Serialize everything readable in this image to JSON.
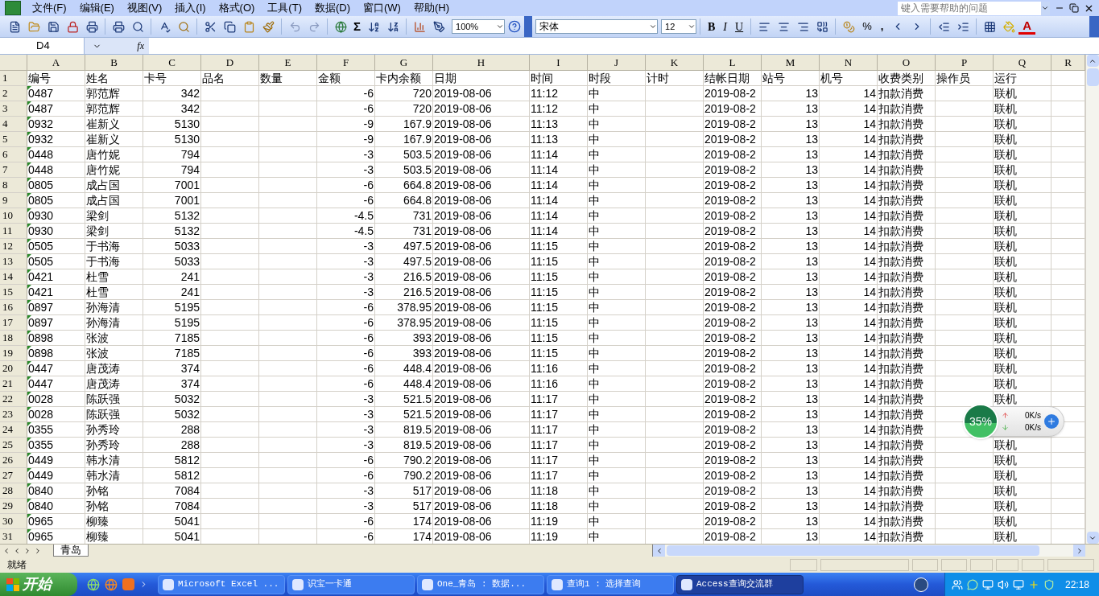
{
  "menu_bar": [
    "文件(F)",
    "编辑(E)",
    "视图(V)",
    "插入(I)",
    "格式(O)",
    "工具(T)",
    "数据(D)",
    "窗口(W)",
    "帮助(H)"
  ],
  "help_field": {
    "placeholder": "键入需要帮助的问题"
  },
  "standard_toolbar": {
    "sum": "Σ",
    "zoom": "100%"
  },
  "formatting_toolbar": {
    "font": "宋体",
    "size": "12",
    "bold": "B",
    "italic": "I",
    "underline": "U",
    "percent": "%",
    "comma": ",",
    "font_color": "A"
  },
  "formula_bar": {
    "name_box": "D4",
    "fx": "fx"
  },
  "columns": [
    "A",
    "B",
    "C",
    "D",
    "E",
    "F",
    "G",
    "H",
    "I",
    "J",
    "K",
    "L",
    "M",
    "N",
    "O",
    "P",
    "Q",
    "R"
  ],
  "rows": [
    {
      "number": "1",
      "cells": {
        "A": "编号",
        "B": "姓名",
        "C": "卡号",
        "D": "品名",
        "E": "数量",
        "F": "金额",
        "G": "卡内余额",
        "H": "日期",
        "I": "时间",
        "J": "时段",
        "K": "计时",
        "L": "结帐日期",
        "M": "站号",
        "N": "机号",
        "O": "收费类别",
        "P": "操作员",
        "Q": "运行"
      }
    },
    {
      "number": "2",
      "cells": {
        "A": "0487",
        "B": "郭范辉",
        "C": "342",
        "F": "-6",
        "G": "720",
        "H": "2019-08-06",
        "I": "11:12",
        "J": "中",
        "L": "2019-08-2",
        "M": "13",
        "N": "14",
        "O": "扣款消费",
        "Q": "联机"
      }
    },
    {
      "number": "3",
      "cells": {
        "A": "0487",
        "B": "郭范辉",
        "C": "342",
        "F": "-6",
        "G": "720",
        "H": "2019-08-06",
        "I": "11:12",
        "J": "中",
        "L": "2019-08-2",
        "M": "13",
        "N": "14",
        "O": "扣款消费",
        "Q": "联机"
      }
    },
    {
      "number": "4",
      "cells": {
        "A": "0932",
        "B": "崔新义",
        "C": "5130",
        "F": "-9",
        "G": "167.9",
        "H": "2019-08-06",
        "I": "11:13",
        "J": "中",
        "L": "2019-08-2",
        "M": "13",
        "N": "14",
        "O": "扣款消费",
        "Q": "联机"
      }
    },
    {
      "number": "5",
      "cells": {
        "A": "0932",
        "B": "崔新义",
        "C": "5130",
        "F": "-9",
        "G": "167.9",
        "H": "2019-08-06",
        "I": "11:13",
        "J": "中",
        "L": "2019-08-2",
        "M": "13",
        "N": "14",
        "O": "扣款消费",
        "Q": "联机"
      }
    },
    {
      "number": "6",
      "cells": {
        "A": "0448",
        "B": "唐竹妮",
        "C": "794",
        "F": "-3",
        "G": "503.5",
        "H": "2019-08-06",
        "I": "11:14",
        "J": "中",
        "L": "2019-08-2",
        "M": "13",
        "N": "14",
        "O": "扣款消费",
        "Q": "联机"
      }
    },
    {
      "number": "7",
      "cells": {
        "A": "0448",
        "B": "唐竹妮",
        "C": "794",
        "F": "-3",
        "G": "503.5",
        "H": "2019-08-06",
        "I": "11:14",
        "J": "中",
        "L": "2019-08-2",
        "M": "13",
        "N": "14",
        "O": "扣款消费",
        "Q": "联机"
      }
    },
    {
      "number": "8",
      "cells": {
        "A": "0805",
        "B": "成占国",
        "C": "7001",
        "F": "-6",
        "G": "664.8",
        "H": "2019-08-06",
        "I": "11:14",
        "J": "中",
        "L": "2019-08-2",
        "M": "13",
        "N": "14",
        "O": "扣款消费",
        "Q": "联机"
      }
    },
    {
      "number": "9",
      "cells": {
        "A": "0805",
        "B": "成占国",
        "C": "7001",
        "F": "-6",
        "G": "664.8",
        "H": "2019-08-06",
        "I": "11:14",
        "J": "中",
        "L": "2019-08-2",
        "M": "13",
        "N": "14",
        "O": "扣款消费",
        "Q": "联机"
      }
    },
    {
      "number": "10",
      "cells": {
        "A": "0930",
        "B": "梁剑",
        "C": "5132",
        "F": "-4.5",
        "G": "731",
        "H": "2019-08-06",
        "I": "11:14",
        "J": "中",
        "L": "2019-08-2",
        "M": "13",
        "N": "14",
        "O": "扣款消费",
        "Q": "联机"
      }
    },
    {
      "number": "11",
      "cells": {
        "A": "0930",
        "B": "梁剑",
        "C": "5132",
        "F": "-4.5",
        "G": "731",
        "H": "2019-08-06",
        "I": "11:14",
        "J": "中",
        "L": "2019-08-2",
        "M": "13",
        "N": "14",
        "O": "扣款消费",
        "Q": "联机"
      }
    },
    {
      "number": "12",
      "cells": {
        "A": "0505",
        "B": "于书海",
        "C": "5033",
        "F": "-3",
        "G": "497.5",
        "H": "2019-08-06",
        "I": "11:15",
        "J": "中",
        "L": "2019-08-2",
        "M": "13",
        "N": "14",
        "O": "扣款消费",
        "Q": "联机"
      }
    },
    {
      "number": "13",
      "cells": {
        "A": "0505",
        "B": "于书海",
        "C": "5033",
        "F": "-3",
        "G": "497.5",
        "H": "2019-08-06",
        "I": "11:15",
        "J": "中",
        "L": "2019-08-2",
        "M": "13",
        "N": "14",
        "O": "扣款消费",
        "Q": "联机"
      }
    },
    {
      "number": "14",
      "cells": {
        "A": "0421",
        "B": "杜雪",
        "C": "241",
        "F": "-3",
        "G": "216.5",
        "H": "2019-08-06",
        "I": "11:15",
        "J": "中",
        "L": "2019-08-2",
        "M": "13",
        "N": "14",
        "O": "扣款消费",
        "Q": "联机"
      }
    },
    {
      "number": "15",
      "cells": {
        "A": "0421",
        "B": "杜雪",
        "C": "241",
        "F": "-3",
        "G": "216.5",
        "H": "2019-08-06",
        "I": "11:15",
        "J": "中",
        "L": "2019-08-2",
        "M": "13",
        "N": "14",
        "O": "扣款消费",
        "Q": "联机"
      }
    },
    {
      "number": "16",
      "cells": {
        "A": "0897",
        "B": "孙海清",
        "C": "5195",
        "F": "-6",
        "G": "378.95",
        "H": "2019-08-06",
        "I": "11:15",
        "J": "中",
        "L": "2019-08-2",
        "M": "13",
        "N": "14",
        "O": "扣款消费",
        "Q": "联机"
      }
    },
    {
      "number": "17",
      "cells": {
        "A": "0897",
        "B": "孙海清",
        "C": "5195",
        "F": "-6",
        "G": "378.95",
        "H": "2019-08-06",
        "I": "11:15",
        "J": "中",
        "L": "2019-08-2",
        "M": "13",
        "N": "14",
        "O": "扣款消费",
        "Q": "联机"
      }
    },
    {
      "number": "18",
      "cells": {
        "A": "0898",
        "B": "张波",
        "C": "7185",
        "F": "-6",
        "G": "393",
        "H": "2019-08-06",
        "I": "11:15",
        "J": "中",
        "L": "2019-08-2",
        "M": "13",
        "N": "14",
        "O": "扣款消费",
        "Q": "联机"
      }
    },
    {
      "number": "19",
      "cells": {
        "A": "0898",
        "B": "张波",
        "C": "7185",
        "F": "-6",
        "G": "393",
        "H": "2019-08-06",
        "I": "11:15",
        "J": "中",
        "L": "2019-08-2",
        "M": "13",
        "N": "14",
        "O": "扣款消费",
        "Q": "联机"
      }
    },
    {
      "number": "20",
      "cells": {
        "A": "0447",
        "B": "唐茂涛",
        "C": "374",
        "F": "-6",
        "G": "448.4",
        "H": "2019-08-06",
        "I": "11:16",
        "J": "中",
        "L": "2019-08-2",
        "M": "13",
        "N": "14",
        "O": "扣款消费",
        "Q": "联机"
      }
    },
    {
      "number": "21",
      "cells": {
        "A": "0447",
        "B": "唐茂涛",
        "C": "374",
        "F": "-6",
        "G": "448.4",
        "H": "2019-08-06",
        "I": "11:16",
        "J": "中",
        "L": "2019-08-2",
        "M": "13",
        "N": "14",
        "O": "扣款消费",
        "Q": "联机"
      }
    },
    {
      "number": "22",
      "cells": {
        "A": "0028",
        "B": "陈跃强",
        "C": "5032",
        "F": "-3",
        "G": "521.5",
        "H": "2019-08-06",
        "I": "11:17",
        "J": "中",
        "L": "2019-08-2",
        "M": "13",
        "N": "14",
        "O": "扣款消费",
        "Q": "联机"
      }
    },
    {
      "number": "23",
      "cells": {
        "A": "0028",
        "B": "陈跃强",
        "C": "5032",
        "F": "-3",
        "G": "521.5",
        "H": "2019-08-06",
        "I": "11:17",
        "J": "中",
        "L": "2019-08-2",
        "M": "13",
        "N": "14",
        "O": "扣款消费"
      }
    },
    {
      "number": "24",
      "cells": {
        "A": "0355",
        "B": "孙秀玲",
        "C": "288",
        "F": "-3",
        "G": "819.5",
        "H": "2019-08-06",
        "I": "11:17",
        "J": "中",
        "L": "2019-08-2",
        "M": "13",
        "N": "14",
        "O": "扣款消费"
      }
    },
    {
      "number": "25",
      "cells": {
        "A": "0355",
        "B": "孙秀玲",
        "C": "288",
        "F": "-3",
        "G": "819.5",
        "H": "2019-08-06",
        "I": "11:17",
        "J": "中",
        "L": "2019-08-2",
        "M": "13",
        "N": "14",
        "O": "扣款消费",
        "Q": "联机"
      }
    },
    {
      "number": "26",
      "cells": {
        "A": "0449",
        "B": "韩水清",
        "C": "5812",
        "F": "-6",
        "G": "790.2",
        "H": "2019-08-06",
        "I": "11:17",
        "J": "中",
        "L": "2019-08-2",
        "M": "13",
        "N": "14",
        "O": "扣款消费",
        "Q": "联机"
      }
    },
    {
      "number": "27",
      "cells": {
        "A": "0449",
        "B": "韩水清",
        "C": "5812",
        "F": "-6",
        "G": "790.2",
        "H": "2019-08-06",
        "I": "11:17",
        "J": "中",
        "L": "2019-08-2",
        "M": "13",
        "N": "14",
        "O": "扣款消费",
        "Q": "联机"
      }
    },
    {
      "number": "28",
      "cells": {
        "A": "0840",
        "B": "孙铭",
        "C": "7084",
        "F": "-3",
        "G": "517",
        "H": "2019-08-06",
        "I": "11:18",
        "J": "中",
        "L": "2019-08-2",
        "M": "13",
        "N": "14",
        "O": "扣款消费",
        "Q": "联机"
      }
    },
    {
      "number": "29",
      "cells": {
        "A": "0840",
        "B": "孙铭",
        "C": "7084",
        "F": "-3",
        "G": "517",
        "H": "2019-08-06",
        "I": "11:18",
        "J": "中",
        "L": "2019-08-2",
        "M": "13",
        "N": "14",
        "O": "扣款消费",
        "Q": "联机"
      }
    },
    {
      "number": "30",
      "cells": {
        "A": "0965",
        "B": "柳臻",
        "C": "5041",
        "F": "-6",
        "G": "174",
        "H": "2019-08-06",
        "I": "11:19",
        "J": "中",
        "L": "2019-08-2",
        "M": "13",
        "N": "14",
        "O": "扣款消费",
        "Q": "联机"
      }
    },
    {
      "number": "31",
      "cells": {
        "A": "0965",
        "B": "柳臻",
        "C": "5041",
        "F": "-6",
        "G": "174",
        "H": "2019-08-06",
        "I": "11:19",
        "J": "中",
        "L": "2019-08-2",
        "M": "13",
        "N": "14",
        "O": "扣款消费",
        "Q": "联机"
      }
    }
  ],
  "sheet_tabs": [
    {
      "label": "青岛",
      "selected": true
    }
  ],
  "status_bar": {
    "text": "就绪"
  },
  "speed_widget": {
    "percent": "35%",
    "upload": "0K/s",
    "download": "0K/s"
  },
  "taskbar": {
    "start": "开始",
    "tasks": [
      {
        "label": "Microsoft Excel ...",
        "selected": false
      },
      {
        "label": "识宝一卡通",
        "selected": false
      },
      {
        "label": "One_青岛 : 数据...",
        "selected": false
      },
      {
        "label": "查询1 : 选择查询",
        "selected": false
      },
      {
        "label": "Access查询交流群",
        "selected": true
      }
    ],
    "clock": "22:18"
  }
}
